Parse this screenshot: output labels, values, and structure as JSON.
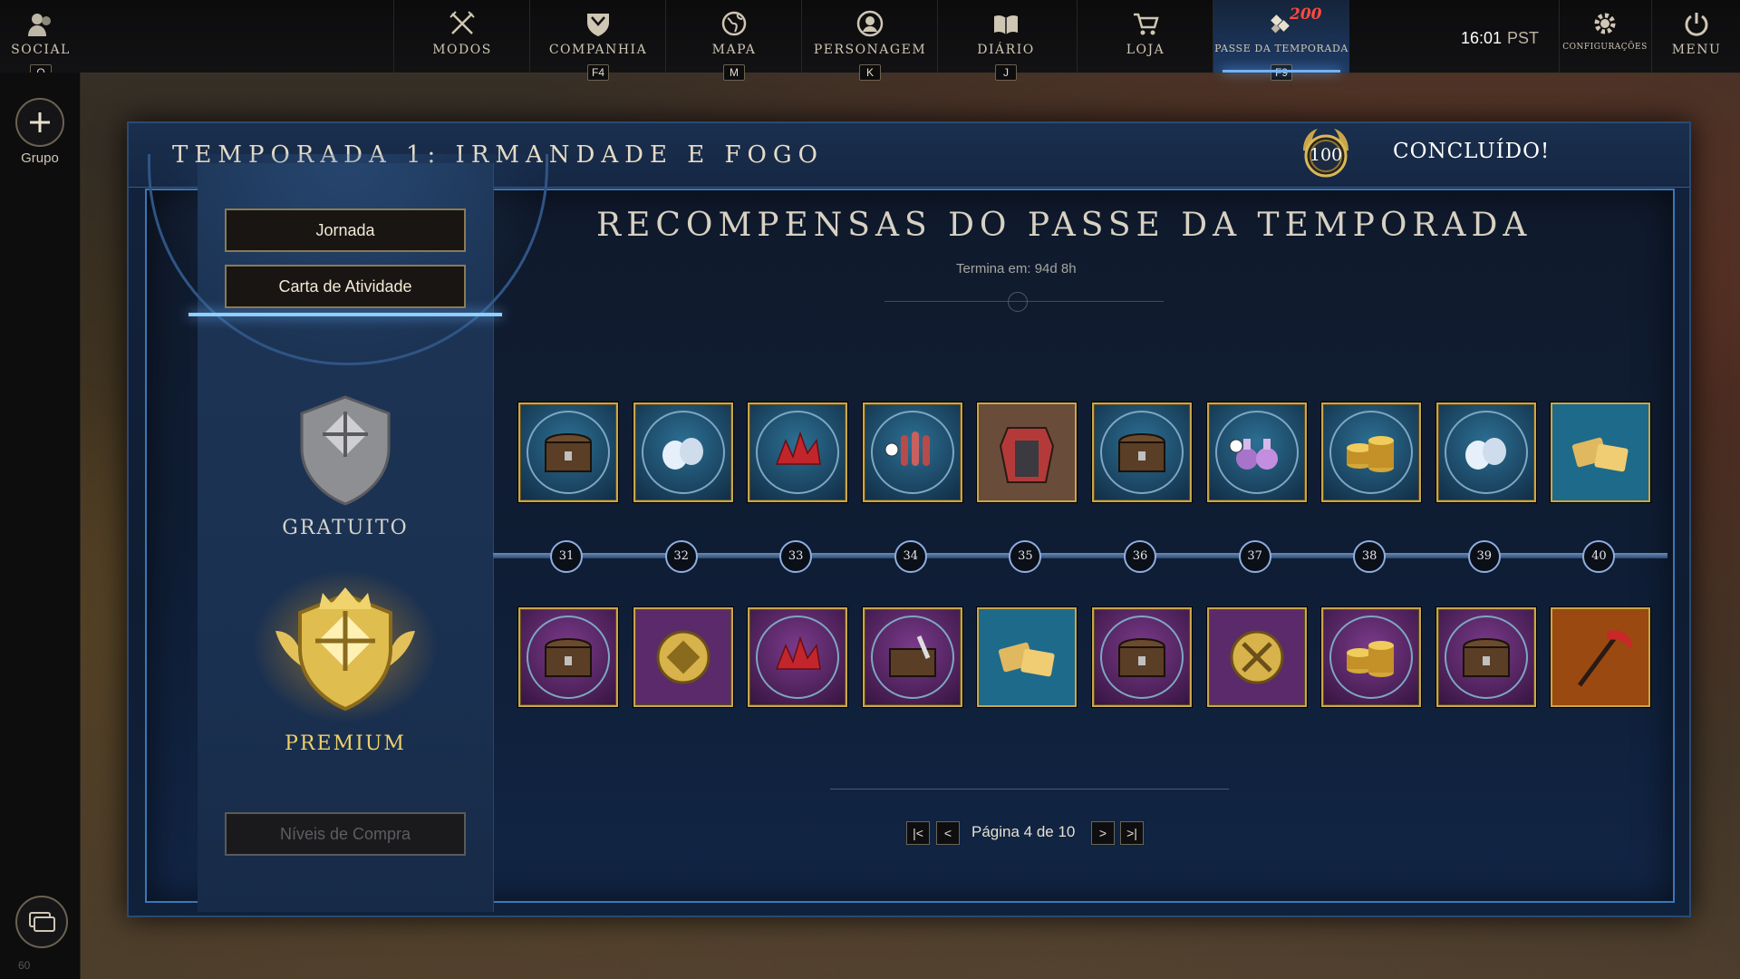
{
  "nav": {
    "social": {
      "label": "SOCIAL",
      "key": "O"
    },
    "items": [
      {
        "label": "MODOS",
        "key": "",
        "icon": "crossed-swords-icon"
      },
      {
        "label": "COMPANHIA",
        "key": "F4",
        "icon": "company-shield-icon"
      },
      {
        "label": "MAPA",
        "key": "M",
        "icon": "globe-icon"
      },
      {
        "label": "PERSONAGEM",
        "key": "K",
        "icon": "character-icon"
      },
      {
        "label": "DIÁRIO",
        "key": "J",
        "icon": "journal-icon"
      },
      {
        "label": "LOJA",
        "key": "",
        "icon": "cart-icon"
      },
      {
        "label": "PASSE DA TEMPORADA",
        "key": "F9",
        "icon": "season-pass-icon",
        "badge": "200"
      }
    ],
    "time": "16:01",
    "timezone": "PST",
    "settings_label": "CONFIGURAÇÕES",
    "menu_label": "MENU"
  },
  "sidebar": {
    "group_label": "Grupo",
    "bottom_number": "60"
  },
  "panel": {
    "season_title": "TEMPORADA 1: IRMANDADE E FOGO",
    "level": "100",
    "status": "CONCLUÍDO!",
    "rewards_title": "RECOMPENSAS DO PASSE DA TEMPORADA",
    "ends_label": "Termina em: 94d 8h"
  },
  "tabs": {
    "journey": "Jornada",
    "activity_card": "Carta de Atividade",
    "buy_levels": "Níveis de Compra"
  },
  "tiers": {
    "free": "GRATUITO",
    "premium": "PREMIUM"
  },
  "levels": [
    "31",
    "32",
    "33",
    "34",
    "35",
    "36",
    "37",
    "38",
    "39",
    "40"
  ],
  "free_rewards": [
    {
      "icon": "chest-icon",
      "frame": "round"
    },
    {
      "icon": "pearls-icon",
      "frame": "round"
    },
    {
      "icon": "red-crystals-icon",
      "frame": "round"
    },
    {
      "icon": "vials-icon",
      "frame": "round"
    },
    {
      "icon": "armor-skin-icon",
      "frame": "square"
    },
    {
      "icon": "chest-icon",
      "frame": "round"
    },
    {
      "icon": "potions-icon",
      "frame": "round"
    },
    {
      "icon": "coins-icon",
      "frame": "round"
    },
    {
      "icon": "pearls-icon",
      "frame": "round"
    },
    {
      "icon": "tickets-icon",
      "frame": "square"
    }
  ],
  "premium_rewards": [
    {
      "icon": "chest-icon",
      "frame": "round"
    },
    {
      "icon": "emblem-icon",
      "frame": "square"
    },
    {
      "icon": "red-crystals-icon",
      "frame": "round"
    },
    {
      "icon": "brush-chest-icon",
      "frame": "round"
    },
    {
      "icon": "tickets-icon",
      "frame": "square"
    },
    {
      "icon": "chest-icon",
      "frame": "round"
    },
    {
      "icon": "crossed-tools-icon",
      "frame": "square"
    },
    {
      "icon": "coins-icon",
      "frame": "round"
    },
    {
      "icon": "chest-icon",
      "frame": "round"
    },
    {
      "icon": "scythe-icon",
      "frame": "square"
    }
  ],
  "pager": {
    "text": "Página 4 de 10",
    "current": 4,
    "total": 10
  },
  "colors": {
    "gold": "#c9a64a",
    "accent_blue": "#3b77b6",
    "badge_red": "#ff4a3d",
    "panel_bg": "#13233d"
  }
}
